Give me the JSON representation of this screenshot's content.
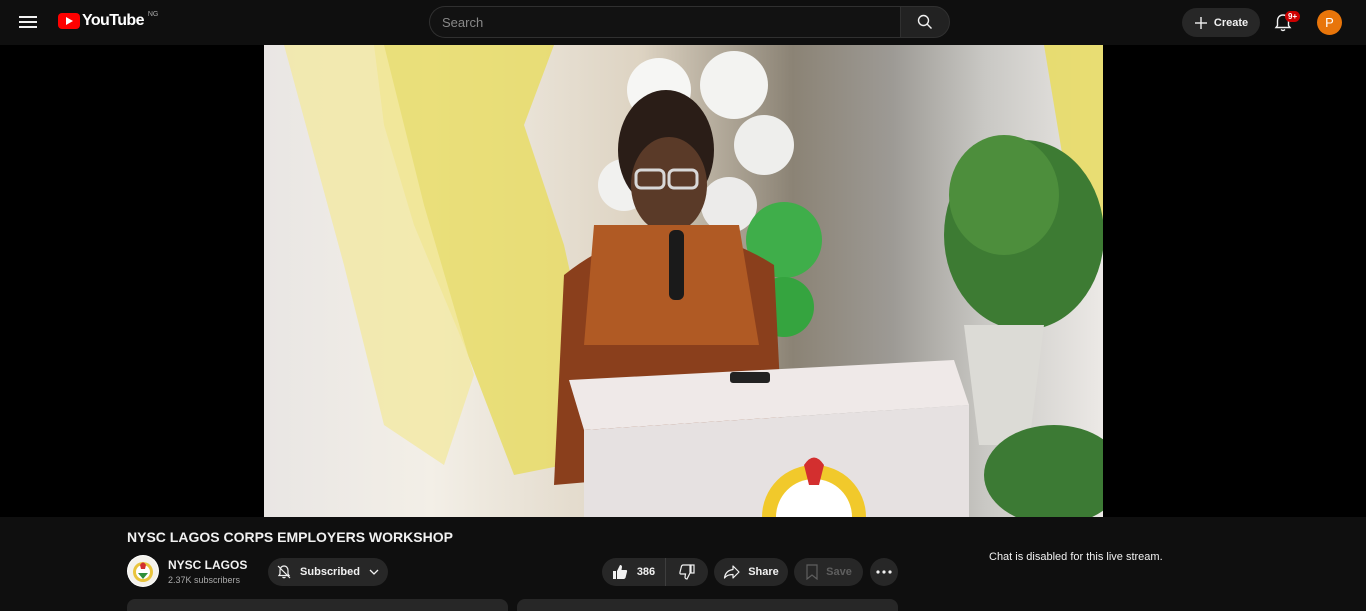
{
  "header": {
    "logo_text": "YouTube",
    "country_code": "NG",
    "search_placeholder": "Search",
    "create_label": "Create",
    "notification_count": "9+",
    "avatar_initial": "P"
  },
  "video": {
    "title": "NYSC LAGOS CORPS EMPLOYERS WORKSHOP",
    "channel_name": "NYSC LAGOS",
    "subscribers": "2.37K subscribers",
    "subscribed_label": "Subscribed",
    "like_count": "386",
    "share_label": "Share",
    "save_label": "Save",
    "chat_disabled_text": "Chat is disabled for this live stream."
  },
  "colors": {
    "background": "#0f0f0f",
    "brand_red": "#ff0000",
    "avatar_bg": "#e8750a",
    "button_bg": "#272727"
  }
}
